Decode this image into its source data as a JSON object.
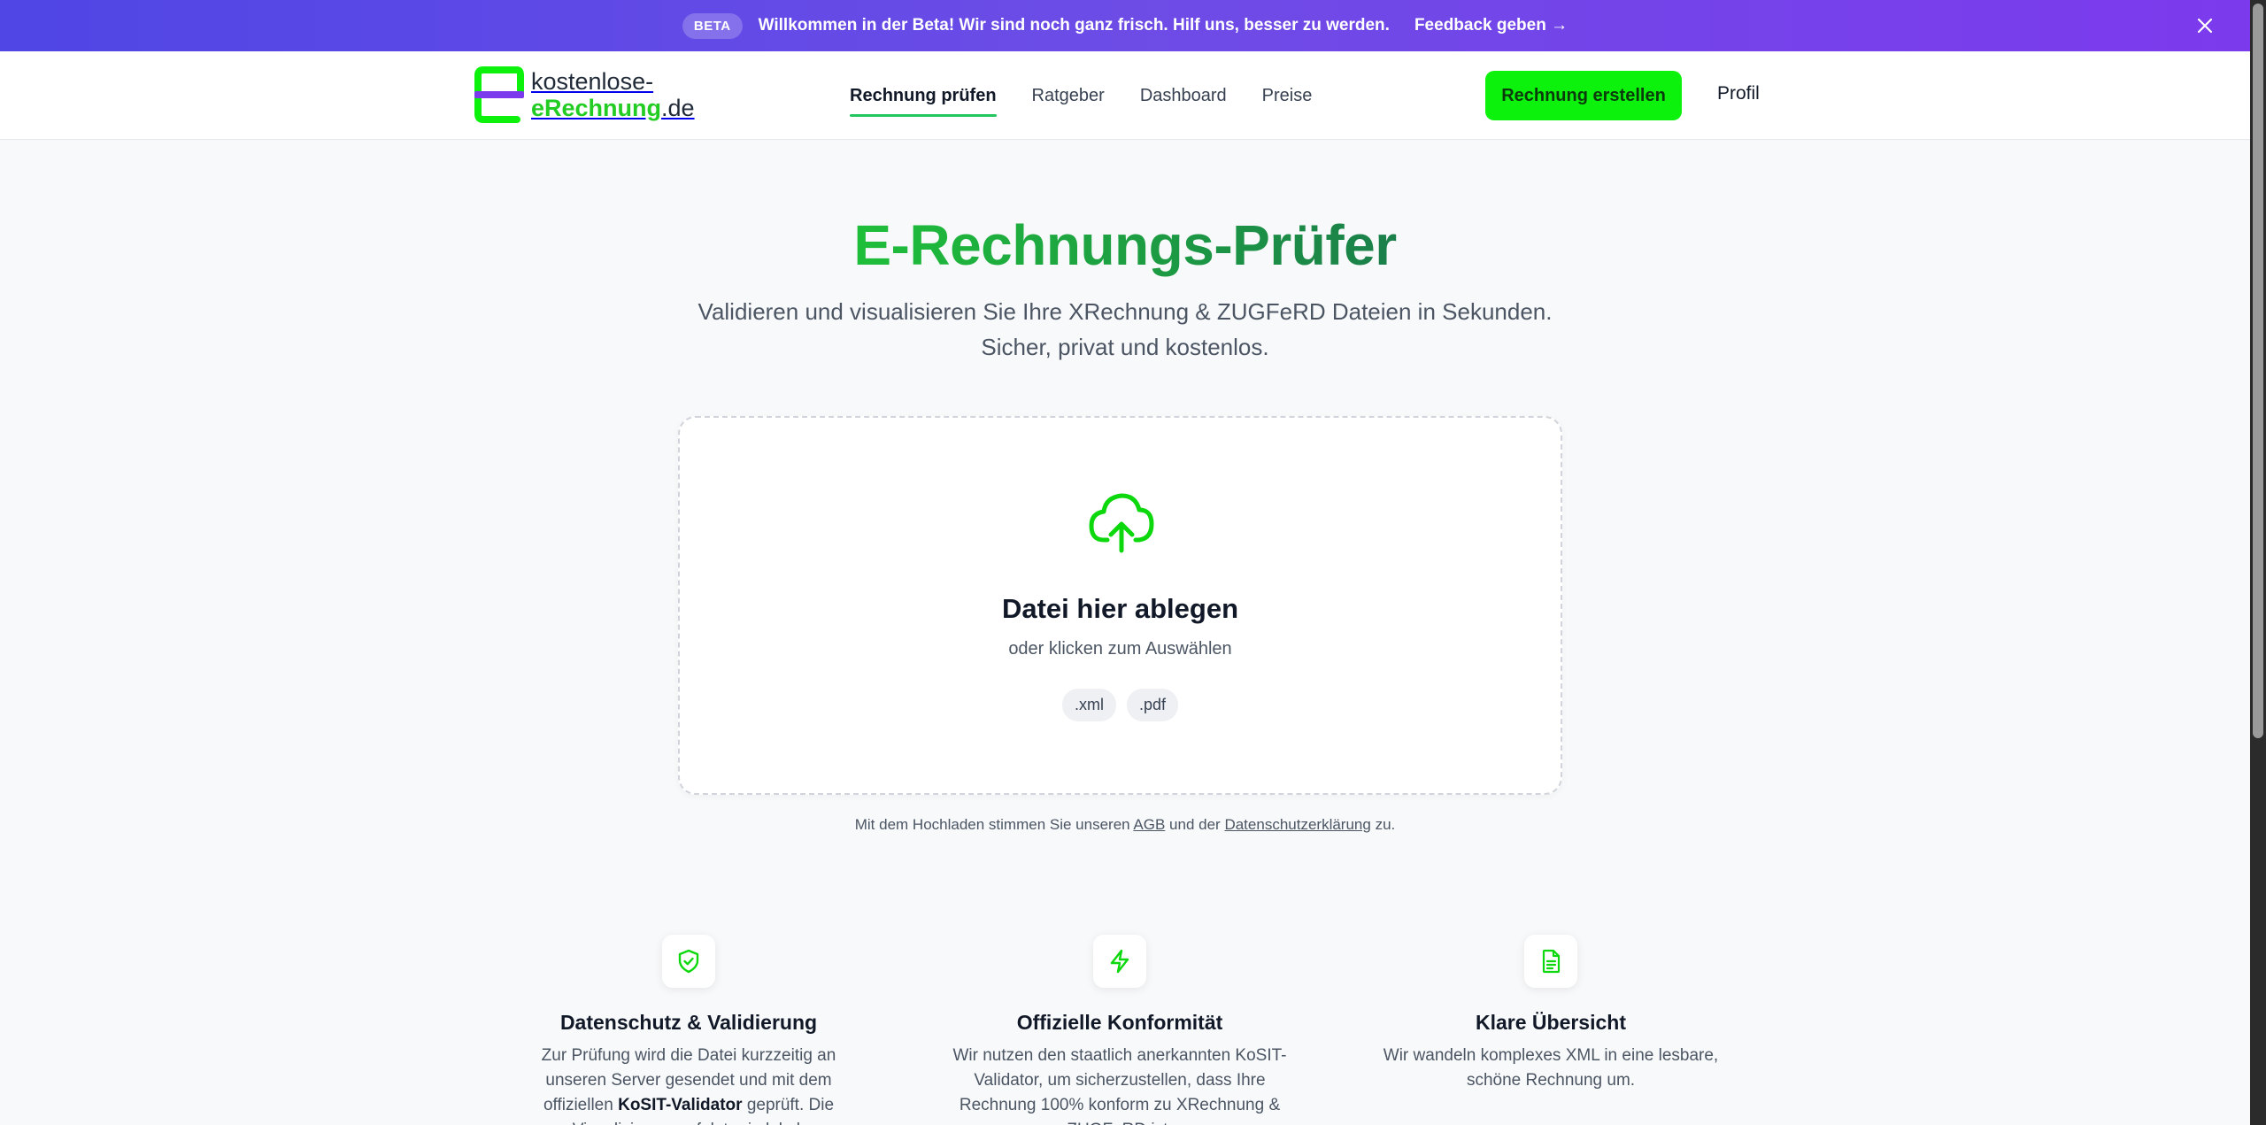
{
  "banner": {
    "badge": "BETA",
    "message": "Willkommen in der Beta! Wir sind noch ganz frisch. Hilf uns, besser zu werden.",
    "link": "Feedback geben →"
  },
  "header": {
    "logo_line1": "kostenlose-",
    "logo_line2_green": "eRechnung",
    "logo_line2_tld": ".de",
    "nav": [
      "Rechnung prüfen",
      "Ratgeber",
      "Dashboard",
      "Preise"
    ],
    "active_nav": "Rechnung prüfen",
    "cta": "Rechnung erstellen",
    "profile": "Profil"
  },
  "hero": {
    "title": "E-Rechnungs-Prüfer",
    "subtitle_line1": "Validieren und visualisieren Sie Ihre XRechnung & ZUGFeRD Dateien in Sekunden.",
    "subtitle_line2": "Sicher, privat und kostenlos."
  },
  "dropzone": {
    "title": "Datei hier ablegen",
    "subtitle": "oder klicken zum Auswählen",
    "formats": [
      ".xml",
      ".pdf"
    ]
  },
  "consent": {
    "prefix": "Mit dem Hochladen stimmen Sie unseren",
    "agb": "AGB",
    "middle": "und der",
    "privacy": "Datenschutzerklärung",
    "suffix": "zu."
  },
  "features": [
    {
      "icon": "shield-check-icon",
      "title": "Datenschutz & Validierung",
      "text_before": "Zur Prüfung wird die Datei kurzzeitig an unseren Server gesendet und mit dem offiziellen",
      "text_bold": "KoSIT-Validator",
      "text_after": "geprüft. Die Visualisierung erfolgt rein lokal."
    },
    {
      "icon": "lightning-icon",
      "title": "Offizielle Konformität",
      "text": "Wir nutzen den staatlich anerkannten KoSIT-Validator, um sicherzustellen, dass Ihre Rechnung 100% konform zu XRechnung & ZUGFeRD ist."
    },
    {
      "icon": "document-icon",
      "title": "Klare Übersicht",
      "text": "Wir wandeln komplexes XML in eine lesbare, schöne Rechnung um."
    }
  ],
  "colors": {
    "banner_start": "#4f46e5",
    "banner_end": "#7c3aed",
    "brand_green": "#0df20d",
    "title_green": "#1aa33a"
  }
}
